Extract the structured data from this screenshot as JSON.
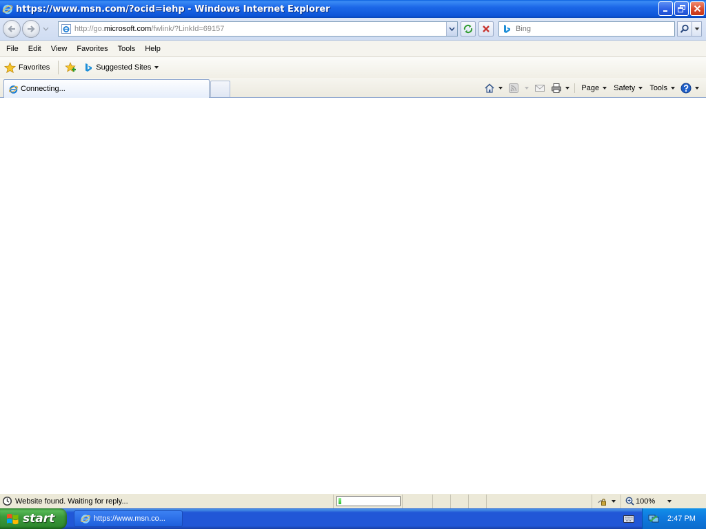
{
  "window": {
    "title": "https://www.msn.com/?ocid=iehp - Windows Internet Explorer",
    "buttons": {
      "minimize_icon": "minimize-icon",
      "restore_icon": "restore-icon",
      "close_icon": "close-icon"
    }
  },
  "address_bar": {
    "url_prefix": "http://go.",
    "url_host": "microsoft.com",
    "url_suffix": "/fwlink/?LinkId=69157",
    "search_placeholder": "Bing"
  },
  "menu": {
    "items": [
      "File",
      "Edit",
      "View",
      "Favorites",
      "Tools",
      "Help"
    ]
  },
  "favorites_bar": {
    "favorites_label": "Favorites",
    "suggested_label": "Suggested Sites"
  },
  "tabs": {
    "active_label": "Connecting..."
  },
  "command_bar": {
    "page_label": "Page",
    "safety_label": "Safety",
    "tools_label": "Tools"
  },
  "status_bar": {
    "text": "Website found. Waiting for reply...",
    "progress_fraction": 0.05,
    "zoom": "100%"
  },
  "taskbar": {
    "start_label": "start",
    "task_label": "https://www.msn.co...",
    "clock": "2:47 PM"
  },
  "colors": {
    "titlebar": "#0d55d8",
    "taskbar": "#2157d7",
    "start_button": "#3c9a3c",
    "progress_fill": "#2fba2f"
  }
}
